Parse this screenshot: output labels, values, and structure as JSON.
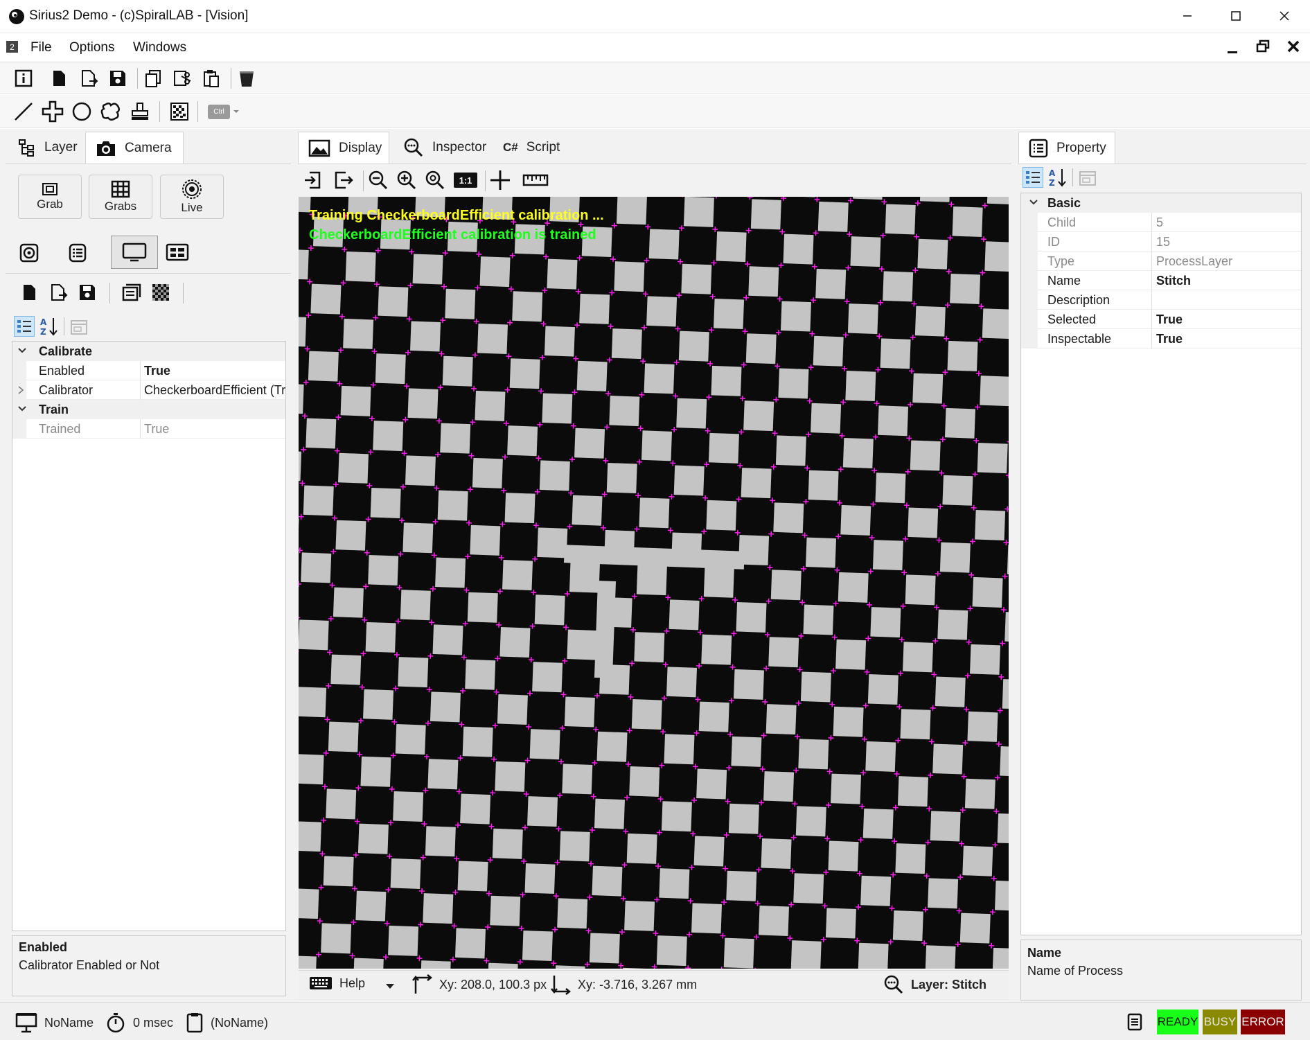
{
  "window": {
    "title": "Sirius2 Demo - (c)SpiralLAB - [Vision]",
    "mdi_badge": "2"
  },
  "menu": {
    "file": "File",
    "options": "Options",
    "windows": "Windows"
  },
  "left_panel": {
    "tabs": [
      {
        "label": "Layer"
      },
      {
        "label": "Camera"
      }
    ],
    "buttons": {
      "grab": "Grab",
      "grabs": "Grabs",
      "live": "Live"
    },
    "property_grid": {
      "categories": [
        {
          "name": "Calibrate",
          "rows": [
            {
              "name": "Enabled",
              "value": "True"
            },
            {
              "name": "Calibrator",
              "value": "CheckerboardEfficient (Trained)"
            }
          ]
        },
        {
          "name": "Train",
          "rows": [
            {
              "name": "Trained",
              "value": "True"
            }
          ]
        }
      ]
    },
    "help": {
      "title": "Enabled",
      "text": "Calibrator Enabled or Not"
    }
  },
  "center_panel": {
    "tabs": [
      {
        "label": "Display"
      },
      {
        "label": "Inspector"
      },
      {
        "label": "Script",
        "icon_text": "C#"
      }
    ],
    "zoom_badge": "1:1",
    "overlay": {
      "line1": "Training CheckerboardEfficient calibration ...",
      "line2": "CheckerboardEfficient calibration is trained",
      "line1_color": "#ffff1e",
      "line2_color": "#1eff1e"
    },
    "status": {
      "help": "Help",
      "xy_px": "Xy: 208.0, 100.3 px",
      "xy_mm": "Xy: -3.716, 3.267 mm",
      "layer": "Layer: Stitch"
    }
  },
  "right_panel": {
    "tab": "Property",
    "property_grid": {
      "category": "Basic",
      "rows": [
        {
          "name": "Child",
          "value": "5"
        },
        {
          "name": "ID",
          "value": "15"
        },
        {
          "name": "Type",
          "value": "ProcessLayer"
        },
        {
          "name": "Name",
          "value": "Stitch"
        },
        {
          "name": "Description",
          "value": ""
        },
        {
          "name": "Selected",
          "value": "True"
        },
        {
          "name": "Inspectable",
          "value": "True"
        }
      ]
    },
    "help": {
      "title": "Name",
      "text": "Name of Process"
    }
  },
  "statusbar": {
    "name": "NoName",
    "time": "0 msec",
    "doc": "(NoName)",
    "ready": "READY",
    "busy": "BUSY",
    "error": "ERROR",
    "ready_color": "#19ff19",
    "busy_color": "#8a8a00",
    "error_color": "#8b0000"
  },
  "ctrl_label": "Ctrl"
}
